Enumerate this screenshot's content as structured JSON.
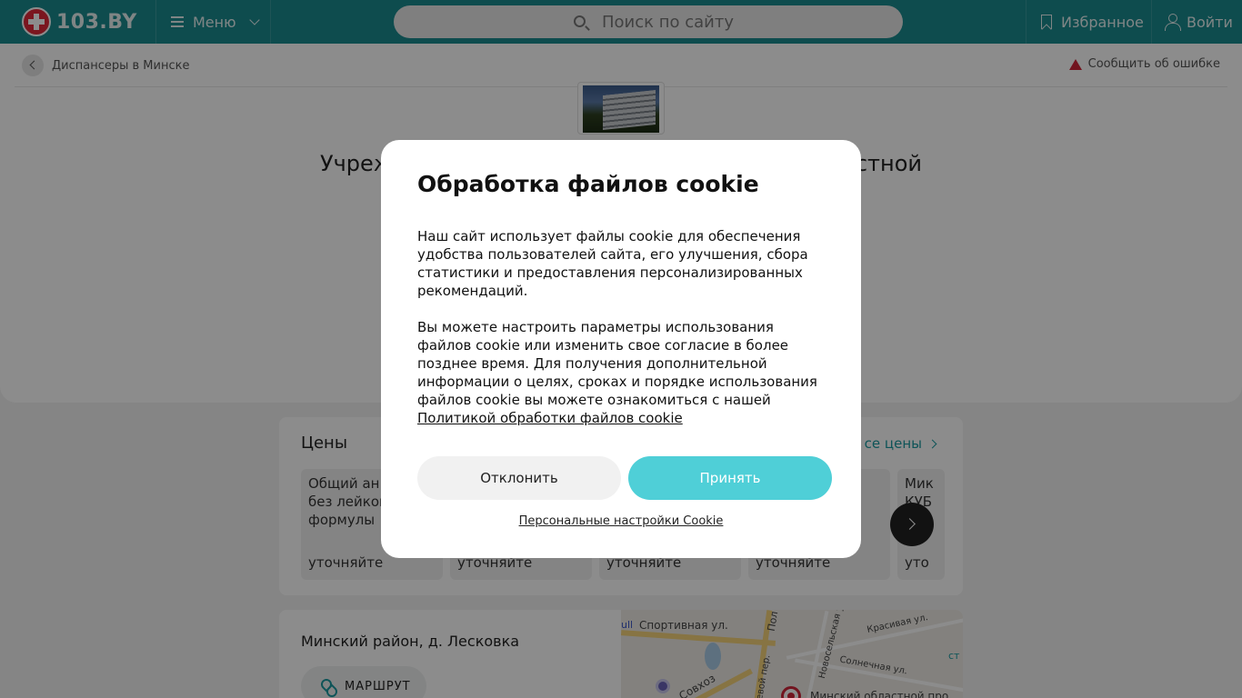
{
  "header": {
    "logo_text": "103.BY",
    "menu_label": "Меню",
    "search_placeholder": "Поиск по сайту",
    "favorites_label": "Избранное",
    "login_label": "Войти"
  },
  "breadcrumb": {
    "label": "Диспансеры в Минске"
  },
  "report_error_label": "Сообщить об ошибке",
  "org_title": {
    "left": "Учреж",
    "right": "стной"
  },
  "prices": {
    "title": "Цены",
    "all_link": "се цены",
    "items": [
      {
        "name": "Общий ан крови без лейкоцит формулы",
        "value": "уточняйте"
      },
      {
        "name": "",
        "value": "уточняйте"
      },
      {
        "name": "",
        "value": "уточняйте"
      },
      {
        "name": "",
        "value": "уточняйте"
      },
      {
        "name": "Мик КУБ",
        "value": "уто"
      }
    ]
  },
  "address": {
    "text": "Минский район, д. Лесковка",
    "route_label": "МАРШРУТ"
  },
  "map": {
    "labels": [
      "ull",
      "Спортивная ул.",
      "Пол",
      "Новосельская у",
      "Красивая ул.",
      "Солнечная ул.",
      "ст",
      "Совхоз",
      "ревой пер.",
      "Минский областной про"
    ]
  },
  "cookie_modal": {
    "title": "Обработка файлов cookie",
    "paragraph1": "Наш сайт использует файлы cookie для обеспечения удобства пользователей сайта, его улучшения, сбора статистики и предоставления персонализированных рекомендаций.",
    "paragraph2": "Вы можете настроить параметры использования файлов cookie или изменить свое согласие в более позднее время. Для получения дополнительной информации о целях, сроках и порядке использования файлов cookie вы можете ознакомиться с нашей",
    "policy_link": "Политикой обработки файлов cookie",
    "decline_label": "Отклонить",
    "accept_label": "Принять",
    "settings_link": "Персональные настройки Cookie"
  },
  "colors": {
    "header_bg": "#1a8a8e",
    "accent": "#4fcfd7",
    "brand_red": "#e0283a"
  }
}
